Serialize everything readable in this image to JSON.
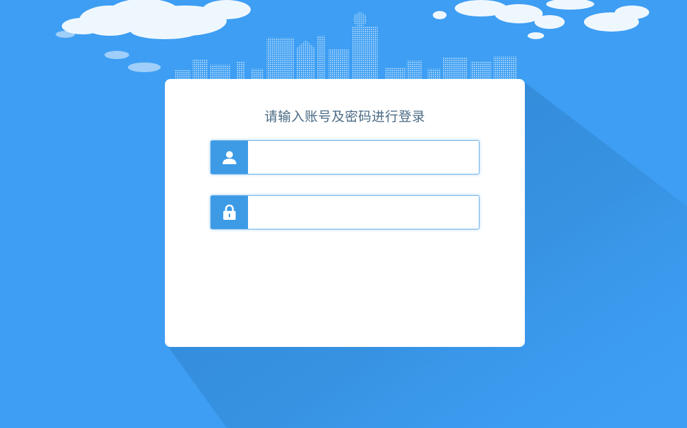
{
  "login": {
    "title": "请输入账号及密码进行登录",
    "username": {
      "value": "",
      "placeholder": "",
      "icon": "user-icon"
    },
    "password": {
      "value": "",
      "placeholder": "",
      "icon": "lock-icon"
    }
  },
  "colors": {
    "background": "#3d9ef3",
    "shadow": "#2f86d0",
    "card": "#ffffff",
    "title": "#4a6a85",
    "icon_bg": "#3d9be6",
    "field_border": "#6fb3e8"
  }
}
